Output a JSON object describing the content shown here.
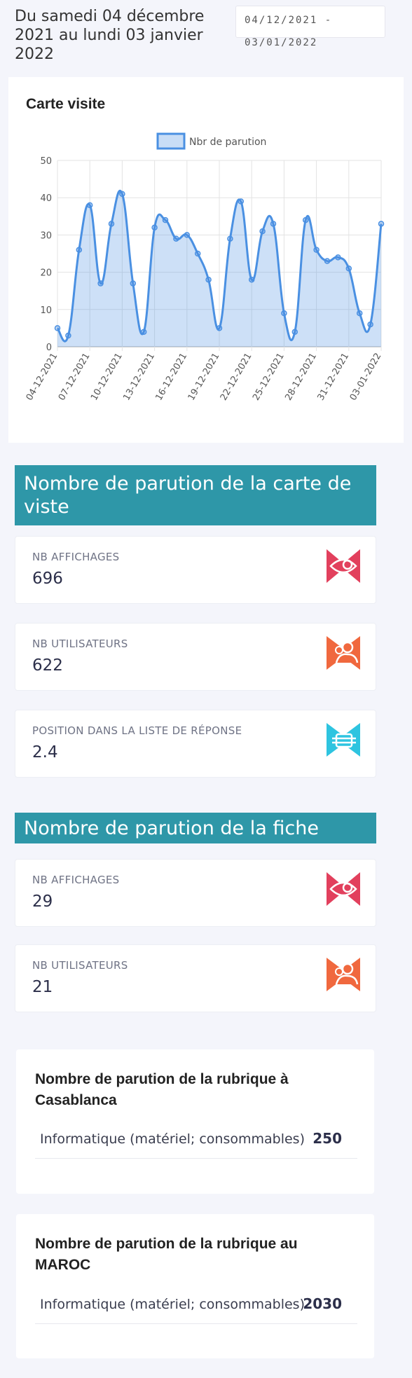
{
  "header": {
    "period_text": "Du samedi 04 décembre 2021 au lundi 03 janvier 2022",
    "date_start": "04/12/2021 -",
    "date_end": "03/01/2022"
  },
  "chart_card": {
    "title": "Carte visite"
  },
  "chart_data": {
    "type": "line",
    "title": "Carte visite",
    "legend": [
      "Nbr de parution"
    ],
    "legend_position": "top",
    "ylim": [
      0,
      50
    ],
    "yticks": [
      0,
      10,
      20,
      30,
      40,
      50
    ],
    "grid": true,
    "fill": true,
    "x": [
      "04-12-2021",
      "05-12-2021",
      "06-12-2021",
      "07-12-2021",
      "08-12-2021",
      "09-12-2021",
      "10-12-2021",
      "11-12-2021",
      "12-12-2021",
      "13-12-2021",
      "14-12-2021",
      "15-12-2021",
      "16-12-2021",
      "17-12-2021",
      "18-12-2021",
      "19-12-2021",
      "20-12-2021",
      "21-12-2021",
      "22-12-2021",
      "23-12-2021",
      "24-12-2021",
      "25-12-2021",
      "26-12-2021",
      "27-12-2021",
      "28-12-2021",
      "29-12-2021",
      "30-12-2021",
      "31-12-2021",
      "01-01-2022",
      "02-01-2022",
      "03-01-2022"
    ],
    "xtick_labels": [
      "04-12-2021",
      "07-12-2021",
      "10-12-2021",
      "13-12-2021",
      "16-12-2021",
      "19-12-2021",
      "22-12-2021",
      "25-12-2021",
      "28-12-2021",
      "31-12-2021",
      "03-01-2022"
    ],
    "series": [
      {
        "name": "Nbr de parution",
        "color": "#4a90e2",
        "values": [
          5,
          3,
          26,
          38,
          17,
          33,
          41,
          17,
          4,
          32,
          34,
          29,
          30,
          25,
          18,
          5,
          29,
          39,
          18,
          31,
          33,
          9,
          4,
          34,
          26,
          23,
          24,
          21,
          9,
          6,
          33
        ]
      }
    ]
  },
  "section_carte": {
    "title": "Nombre de parution de la carte de viste",
    "stats": [
      {
        "label": "NB AFFICHAGES",
        "value": "696",
        "icon": "eye-icon",
        "color": "#e2405d"
      },
      {
        "label": "NB UTILISATEURS",
        "value": "622",
        "icon": "users-icon",
        "color": "#f0683e"
      },
      {
        "label": "POSITION DANS LA LISTE DE RÉPONSE",
        "value": "2.4",
        "icon": "list-position-icon",
        "color": "#2ec4e0"
      }
    ]
  },
  "section_fiche": {
    "title": "Nombre de parution de la fiche",
    "stats": [
      {
        "label": "NB AFFICHAGES",
        "value": "29",
        "icon": "eye-icon",
        "color": "#e2405d"
      },
      {
        "label": "NB UTILISATEURS",
        "value": "21",
        "icon": "users-icon",
        "color": "#f0683e"
      }
    ]
  },
  "rubrique_casablanca": {
    "title": "Nombre de parution de la rubrique à Casablanca",
    "rows": [
      {
        "category": "Informatique (matériel; consommables)",
        "value": "250"
      }
    ]
  },
  "rubrique_maroc": {
    "title": "Nombre de parution de la rubrique au MAROC",
    "rows": [
      {
        "category": "Informatique (matériel; consommables)",
        "value": "2030"
      }
    ]
  }
}
